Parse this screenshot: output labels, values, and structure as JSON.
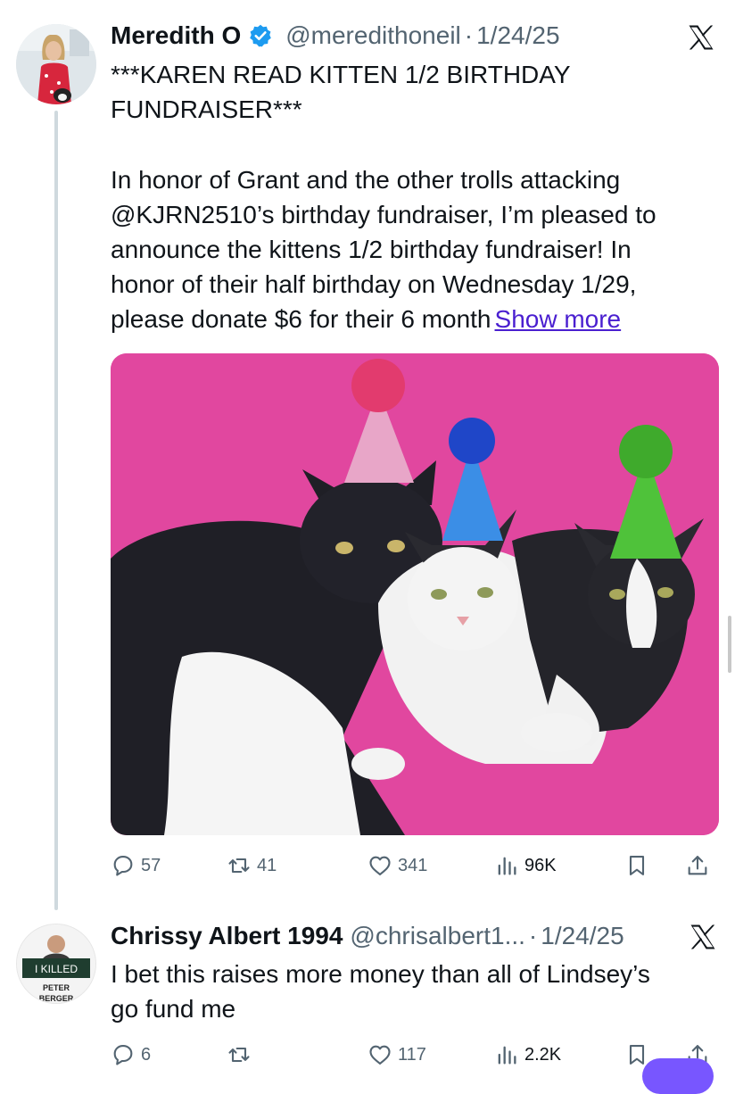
{
  "tweets": [
    {
      "display_name": "Meredith O",
      "verified": true,
      "handle": "@meredithoneil",
      "separator": "·",
      "date": "1/24/25",
      "title_lines": [
        "***KAREN READ KITTEN 1/2 BIRTHDAY",
        "FUNDRAISER***"
      ],
      "text_lines": [
        "In honor of Grant and the other trolls attacking",
        "@KJRN2510’s birthday fundraiser, I’m pleased to",
        "announce the kittens 1/2 birthday fundraiser! In",
        "honor of their half birthday on Wednesday 1/29,",
        "please donate $6 for their 6 month"
      ],
      "show_more": "Show more",
      "stats": {
        "replies": "57",
        "reposts": "41",
        "likes": "341",
        "views": "96K"
      }
    },
    {
      "display_name": "Chrissy Albert 1994",
      "handle": "@chrisalbert1...",
      "separator": "·",
      "date": "1/24/25",
      "text_lines": [
        "I bet this raises more money than all of Lindsey’s",
        "go fund me"
      ],
      "stats": {
        "replies": "6",
        "reposts": "",
        "likes": "117",
        "views": "2.2K"
      },
      "avatar_sign": {
        "line1": "I KILLED",
        "line2": "PETER",
        "line3": "BERGER"
      }
    }
  ],
  "icons": {
    "verified": "verified-badge-icon",
    "platform": "x-logo-icon",
    "reply": "reply-icon",
    "repost": "repost-icon",
    "like": "like-icon",
    "views": "views-icon",
    "bookmark": "bookmark-icon",
    "share": "share-icon"
  },
  "colors": {
    "text": "#0f1419",
    "secondary": "#536471",
    "verified_blue": "#1d9bf0",
    "link": "#4a1fd0",
    "media_bg": "#e1479f"
  }
}
